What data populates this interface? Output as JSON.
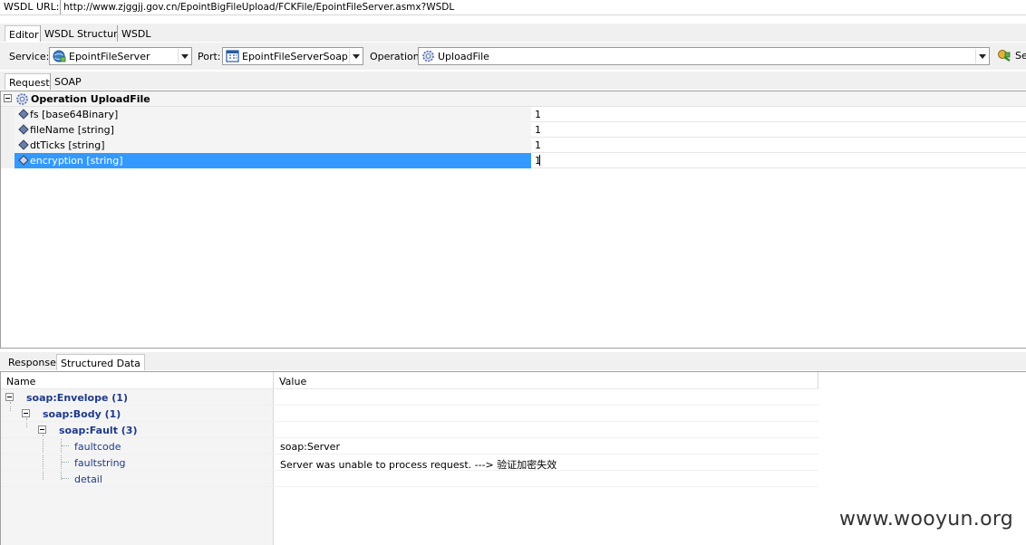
{
  "wsdl": {
    "label": "WSDL URL:",
    "url": "http://www.zjggjj.gov.cn/EpointBigFileUpload/FCKFile/EpointFileServer.asmx?WSDL"
  },
  "editor_tabs": [
    {
      "label": "Editor",
      "active": true
    },
    {
      "label": "WSDL Structure",
      "active": false
    },
    {
      "label": "WSDL",
      "active": false
    }
  ],
  "toolbar": {
    "service_label": "Service:",
    "service_value": "EpointFileServer",
    "port_label": "Port:",
    "port_value": "EpointFileServerSoap",
    "operation_label": "Operation:",
    "operation_value": "UploadFile",
    "send_label": "Se"
  },
  "request_tabs": [
    {
      "label": "Request",
      "active": true
    },
    {
      "label": "SOAP",
      "active": false
    }
  ],
  "operation": {
    "title": "Operation UploadFile",
    "params": [
      {
        "name": "fs [base64Binary]",
        "value": "1",
        "selected": false
      },
      {
        "name": "fileName [string]",
        "value": "1",
        "selected": false
      },
      {
        "name": "dtTicks [string]",
        "value": "1",
        "selected": false
      },
      {
        "name": "encryption [string]",
        "value": "1",
        "selected": true
      }
    ]
  },
  "response_tabs": [
    {
      "label": "Response",
      "active": false
    },
    {
      "label": "Structured Data",
      "active": true
    }
  ],
  "response": {
    "col_name": "Name",
    "col_value": "Value",
    "rows": [
      {
        "name": "soap:Envelope (1)",
        "value": "",
        "bold": true,
        "level": 0,
        "expandable": true
      },
      {
        "name": "soap:Body (1)",
        "value": "",
        "bold": true,
        "level": 1,
        "expandable": true
      },
      {
        "name": "soap:Fault (3)",
        "value": "",
        "bold": true,
        "level": 2,
        "expandable": true
      },
      {
        "name": "faultcode",
        "value": "soap:Server",
        "bold": false,
        "level": 3,
        "expandable": false
      },
      {
        "name": "faultstring",
        "value": "Server was unable to process request. ---> 验证加密失效",
        "bold": false,
        "level": 3,
        "expandable": false
      },
      {
        "name": "detail",
        "value": "",
        "bold": false,
        "level": 3,
        "expandable": false
      }
    ]
  },
  "watermark": "www.wooyun.org",
  "icons": {
    "service": "service-globe-icon",
    "port": "port-grid-icon",
    "operation": "gear-icon",
    "send": "send-icon",
    "param": "diamond-icon"
  }
}
